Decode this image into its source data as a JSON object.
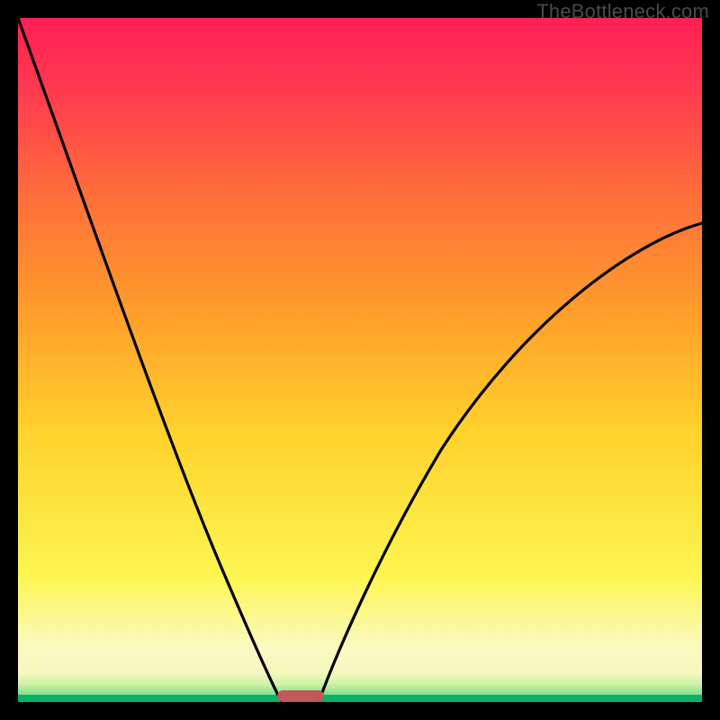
{
  "watermark": "TheBottleneck.com",
  "colors": {
    "frame": "#000000",
    "gradient_top": "#ff1f55",
    "gradient_mid": "#fef551",
    "gradient_bottom": "#05b36a",
    "curve": "#000000",
    "marker": "#c1595b",
    "watermark_text": "#4a4a4a"
  },
  "chart_data": {
    "type": "line",
    "title": "",
    "xlabel": "",
    "ylabel": "",
    "xlim": [
      0,
      100
    ],
    "ylim": [
      0,
      100
    ],
    "grid": false,
    "annotations": [
      {
        "name": "minimum-marker",
        "x": 41,
        "y": 0,
        "width": 7
      }
    ],
    "series": [
      {
        "name": "left-branch",
        "x": [
          0,
          3,
          6,
          9,
          12,
          15,
          18,
          21,
          24,
          27,
          30,
          33,
          35,
          37,
          38.5
        ],
        "values": [
          100,
          90,
          80,
          70,
          61,
          52,
          44,
          36,
          29,
          22,
          16,
          10,
          6,
          2.5,
          0
        ]
      },
      {
        "name": "right-branch",
        "x": [
          44,
          46,
          49,
          52,
          56,
          60,
          64,
          68,
          73,
          78,
          83,
          88,
          93,
          97,
          100
        ],
        "values": [
          0,
          3,
          7,
          12,
          18,
          24,
          30,
          36,
          43,
          49,
          55,
          60,
          65,
          68,
          70
        ]
      }
    ]
  }
}
